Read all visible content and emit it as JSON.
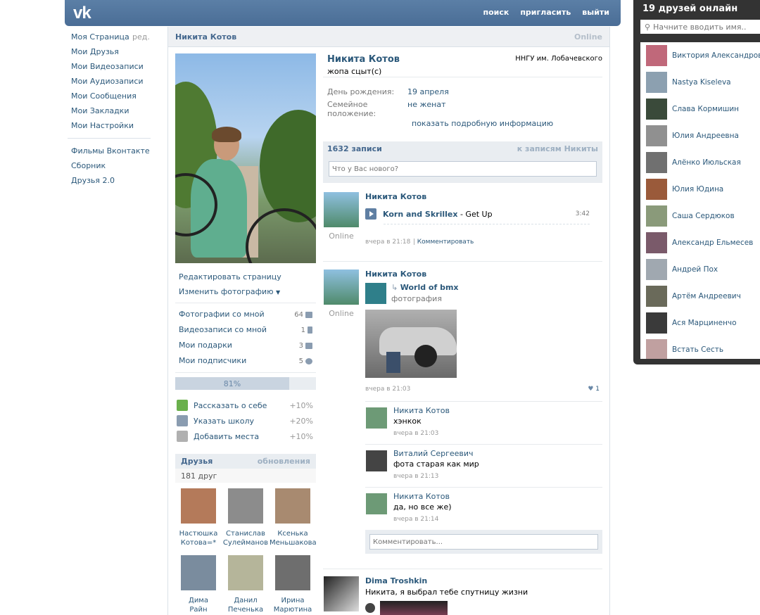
{
  "header": {
    "logo": "vk",
    "nav": [
      "поиск",
      "пригласить",
      "выйти"
    ]
  },
  "left_menu": {
    "items": [
      "Моя Страница",
      "Мои Друзья",
      "Мои Видеозаписи",
      "Мои Аудиозаписи",
      "Мои Сообщения",
      "Мои Закладки",
      "Мои Настройки"
    ],
    "edit": "ред.",
    "apps": [
      "Фильмы Вконтакте",
      "Сборник",
      "Друзья 2.0"
    ]
  },
  "page": {
    "name": "Никита Котов",
    "online": "Online"
  },
  "narrow": {
    "actions": [
      "Редактировать страницу",
      "Изменить фотографию"
    ],
    "stats": [
      {
        "label": "Фотографии со мной",
        "count": "64"
      },
      {
        "label": "Видеозаписи со мной",
        "count": "1"
      },
      {
        "label": "Мои подарки",
        "count": "3"
      },
      {
        "label": "Мои подписчики",
        "count": "5"
      }
    ],
    "progress": {
      "label": "81%",
      "value": 0.81
    },
    "profile_tips": [
      {
        "label": "Рассказать о себе",
        "pct": "+10%",
        "color": "#6ab04c"
      },
      {
        "label": "Указать школу",
        "pct": "+20%",
        "color": "#8a9cb0"
      },
      {
        "label": "Добавить места",
        "pct": "+10%",
        "color": "#b0b0b0"
      }
    ],
    "friends": {
      "title": "Друзья",
      "updates": "обновления",
      "count": "181 друг",
      "items": [
        {
          "line1": "Настюшка",
          "line2": "Котова=*",
          "color": "#b47a5a"
        },
        {
          "line1": "Станислав",
          "line2": "Сулейманов",
          "color": "#8c8c8c"
        },
        {
          "line1": "Ксенька",
          "line2": "Меньшакова",
          "color": "#a88a70"
        },
        {
          "line1": "Дима",
          "line2": "Райн",
          "color": "#7a8c9e"
        },
        {
          "line1": "Данил",
          "line2": "Печенька",
          "color": "#b5b59a"
        },
        {
          "line1": "Ирина",
          "line2": "Марютина",
          "color": "#6e6e6e"
        }
      ]
    }
  },
  "profile": {
    "name": "Никита Котов",
    "status": "жопа сцыт(с)",
    "university": "ННГУ им. Лобачевского",
    "info": [
      {
        "key": "День рождения:",
        "value": "19 апреля"
      },
      {
        "key": "Семейное положение:",
        "value": "не женат"
      }
    ],
    "show_more": "показать подробную информацию"
  },
  "wall": {
    "count": "1632 записи",
    "link": "к записям Никиты",
    "placeholder": "Что у Вас нового?",
    "post1": {
      "author": "Никита Котов",
      "online": "Online",
      "artist": "Korn and Skrillex",
      "title": " - Get Up",
      "duration": "3:42",
      "time": "вчера в 21:18",
      "comment_link": "Комментировать"
    },
    "post2": {
      "author": "Никита Котов",
      "online": "Online",
      "group": "World of bmx",
      "group_sub": "фотография",
      "time": "вчера в 21:03",
      "likes": "1",
      "comments": [
        {
          "name": "Никита Котов",
          "text": "хэнкок",
          "time": "вчера в 21:03",
          "color": "#6d9a76"
        },
        {
          "name": "Виталий Сергеевич",
          "text": "фота старая как мир",
          "time": "вчера в 21:13",
          "color": "#444444"
        },
        {
          "name": "Никита Котов",
          "text": "да, но все же)",
          "time": "вчера в 21:14",
          "color": "#6d9a76"
        }
      ],
      "comment_placeholder": "Комментировать..."
    },
    "post3": {
      "author": "Dima Troshkin",
      "text": "Никита, я выбрал тебе спутницу жизни"
    }
  },
  "online_friends": {
    "title": "19 друзей онлайн",
    "search_placeholder": "Начните вводить имя..",
    "items": [
      {
        "name": "Виктория Александрова",
        "color": "#c0687a"
      },
      {
        "name": "Nastya Kiseleva",
        "color": "#8ca0b0"
      },
      {
        "name": "Слава Кормишин",
        "color": "#3a4a3a"
      },
      {
        "name": "Юлия Андреевна",
        "color": "#909090"
      },
      {
        "name": "Алёнко Июльская",
        "color": "#707070"
      },
      {
        "name": "Юлия Юдина",
        "color": "#9a5a3a"
      },
      {
        "name": "Саша Сердюков",
        "color": "#8a9a7a"
      },
      {
        "name": "Александр Ельмесев",
        "color": "#7a5a6a"
      },
      {
        "name": "Андрей Пох",
        "color": "#a0a8b0"
      },
      {
        "name": "Артём Андреевич",
        "color": "#6a6a5a"
      },
      {
        "name": "Ася Марциненчо",
        "color": "#3a3a3a"
      },
      {
        "name": "Встать Сесть",
        "color": "#c0a0a0"
      }
    ]
  }
}
